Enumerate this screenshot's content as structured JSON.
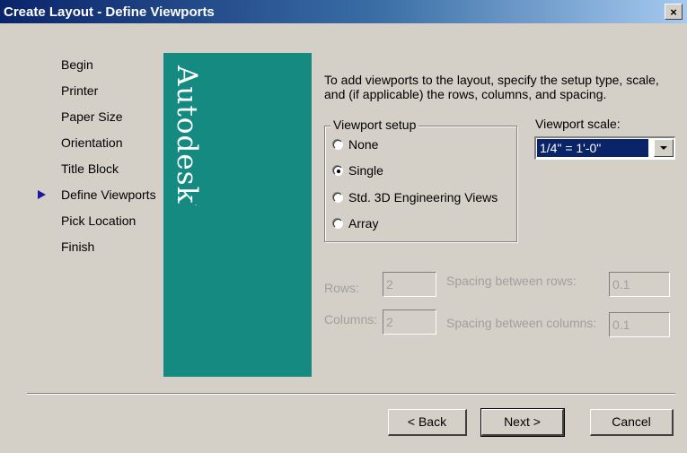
{
  "window": {
    "title": "Create Layout - Define Viewports",
    "close_label": "×"
  },
  "nav": {
    "items": [
      {
        "label": "Begin"
      },
      {
        "label": "Printer"
      },
      {
        "label": "Paper Size"
      },
      {
        "label": "Orientation"
      },
      {
        "label": "Title Block"
      },
      {
        "label": "Define Viewports",
        "current": true
      },
      {
        "label": "Pick Location"
      },
      {
        "label": "Finish"
      }
    ]
  },
  "brand": {
    "text": "Autodesk",
    "mark": "."
  },
  "intro_text": "To add viewports to the layout, specify the setup type, scale, and (if applicable) the rows, columns, and spacing.",
  "viewport_setup": {
    "label": "Viewport setup",
    "options": [
      {
        "label": "None",
        "checked": false
      },
      {
        "label": "Single",
        "checked": true
      },
      {
        "label": "Std. 3D Engineering Views",
        "checked": false
      },
      {
        "label": "Array",
        "checked": false
      }
    ]
  },
  "viewport_scale": {
    "label": "Viewport scale:",
    "value": "1/4\" = 1'-0\""
  },
  "array_fields": {
    "rows_label": "Rows:",
    "rows_value": "2",
    "columns_label": "Columns:",
    "columns_value": "2",
    "row_spacing_label": "Spacing between rows:",
    "row_spacing_value": "0.1",
    "column_spacing_label": "Spacing between columns:",
    "column_spacing_value": "0.1"
  },
  "buttons": {
    "back": "< Back",
    "next": "Next >",
    "cancel": "Cancel"
  },
  "colors": {
    "titlebar": "#0a246a",
    "brand_panel": "#158a80",
    "dialog_bg": "#d4d0c8",
    "nav_arrow": "#1a1aa0"
  }
}
